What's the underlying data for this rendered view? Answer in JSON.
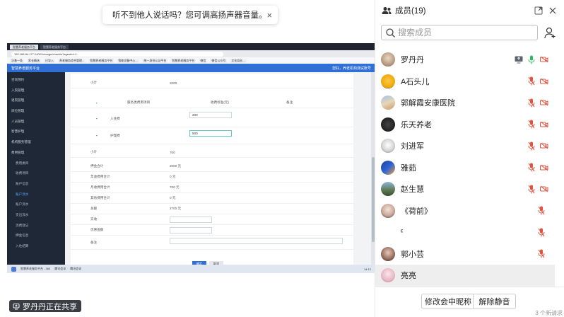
{
  "toast": {
    "message": "听不到他人说话吗？您可调高扬声器音量。",
    "close": "×"
  },
  "sharing_banner": {
    "text": "罗丹丹正在共享"
  },
  "shared_screen": {
    "browser_tabs": [
      "智慧养老服务平台",
      "智慧养老服务平台"
    ],
    "address": "192.168.84.177:14001/charge/checkin?agentId=1...",
    "bookmarks": [
      "沿着一条",
      "家长精选",
      "已导入",
      "养老服务综合管理...",
      "智慧养老服务平台",
      "智能设备中心…",
      "统一身份认证平台",
      "智慧养老服务平台",
      "微信",
      "微信公众号",
      "文化局长…"
    ],
    "app_title": "智慧养老服务平台",
    "header_right": "您好，养老机构测试账号",
    "sidebar": [
      {
        "label": "咨询预约",
        "sub": false
      },
      {
        "label": "入院管理",
        "sub": false
      },
      {
        "label": "退院管理",
        "sub": false
      },
      {
        "label": "床位管理",
        "sub": false
      },
      {
        "label": "人员管理",
        "sub": false
      },
      {
        "label": "智慧护理",
        "sub": false
      },
      {
        "label": "机构服务管理",
        "sub": false
      },
      {
        "label": "费用管理",
        "sub": false
      },
      {
        "label": "费用类目",
        "sub": true
      },
      {
        "label": "收费项目",
        "sub": true
      },
      {
        "label": "账户信息",
        "sub": true
      },
      {
        "label": "账户流水",
        "sub": true,
        "active": true
      },
      {
        "label": "账户流水",
        "sub": true
      },
      {
        "label": "支出流水",
        "sub": true
      },
      {
        "label": "消费登记",
        "sub": true
      },
      {
        "label": "押金信息",
        "sub": true
      },
      {
        "label": "入住结算",
        "sub": true
      }
    ],
    "subtotal_label": "小计",
    "subtotal_1": "2000",
    "table_headers": [
      "服务类费用项目",
      "收费标准(元)",
      "备注"
    ],
    "items": [
      {
        "name": "入住费",
        "value": "200"
      },
      {
        "name": "护理费",
        "value": "500"
      }
    ],
    "subtotal_2": "700",
    "summary": [
      {
        "label": "押金合计",
        "value": "2000 元"
      },
      {
        "label": "年收费用合计",
        "value": "0 元"
      },
      {
        "label": "月收费用合计",
        "value": "700 元"
      },
      {
        "label": "其他费用合计",
        "value": "0 元"
      },
      {
        "label": "总额",
        "value": "2700 元"
      },
      {
        "label": "实收",
        "value": ""
      },
      {
        "label": "优惠金额",
        "value": ""
      },
      {
        "label": "备注",
        "value": ""
      }
    ],
    "buttons": [
      "确定",
      "取消"
    ],
    "taskbar": [
      "智慧养老服务平台 - 360",
      "腾讯会议",
      "腾讯会议"
    ],
    "clock": "14:12"
  },
  "panel": {
    "title": "成员(19)",
    "search_placeholder": "搜索成员",
    "members": [
      {
        "name": "罗丹丹",
        "avatar": "dog",
        "share": true,
        "mic": "on",
        "cam": "off"
      },
      {
        "name": "A石头儿",
        "avatar": "emoji",
        "share": false,
        "mic": "off",
        "cam": "off"
      },
      {
        "name": "郭解霞安康医院",
        "avatar": "group",
        "share": false,
        "mic": "off",
        "cam": "off"
      },
      {
        "name": "乐天养老",
        "avatar": "dark",
        "share": false,
        "mic": "off",
        "cam": "off"
      },
      {
        "name": "刘进军",
        "avatar": "cat",
        "share": false,
        "mic": "off",
        "cam": "off"
      },
      {
        "name": "雅茹",
        "avatar": "blue",
        "share": false,
        "mic": "off",
        "cam": "off"
      },
      {
        "name": "赵生慧",
        "avatar": "scene",
        "share": false,
        "mic": "off",
        "cam": "off"
      },
      {
        "name": "《荷前》",
        "avatar": "girl",
        "share": false,
        "mic": "off",
        "cam": null
      },
      {
        "name": "ᵋ",
        "avatar": "none",
        "share": false,
        "mic": "off",
        "cam": null
      },
      {
        "name": "郭小芸",
        "avatar": "portrait",
        "share": false,
        "mic": "off",
        "cam": null
      },
      {
        "name": "亮亮",
        "avatar": "pink",
        "share": false,
        "mic": null,
        "cam": null,
        "selected": true
      }
    ],
    "footer": {
      "rename_label": "修改会中昵称",
      "unmute_label": "解除静音",
      "new_msg": "3 个新请求"
    }
  },
  "colors": {
    "mic_on": "#2eb85c",
    "mic_off": "#e0533d",
    "brand": "#2f6fd6"
  }
}
